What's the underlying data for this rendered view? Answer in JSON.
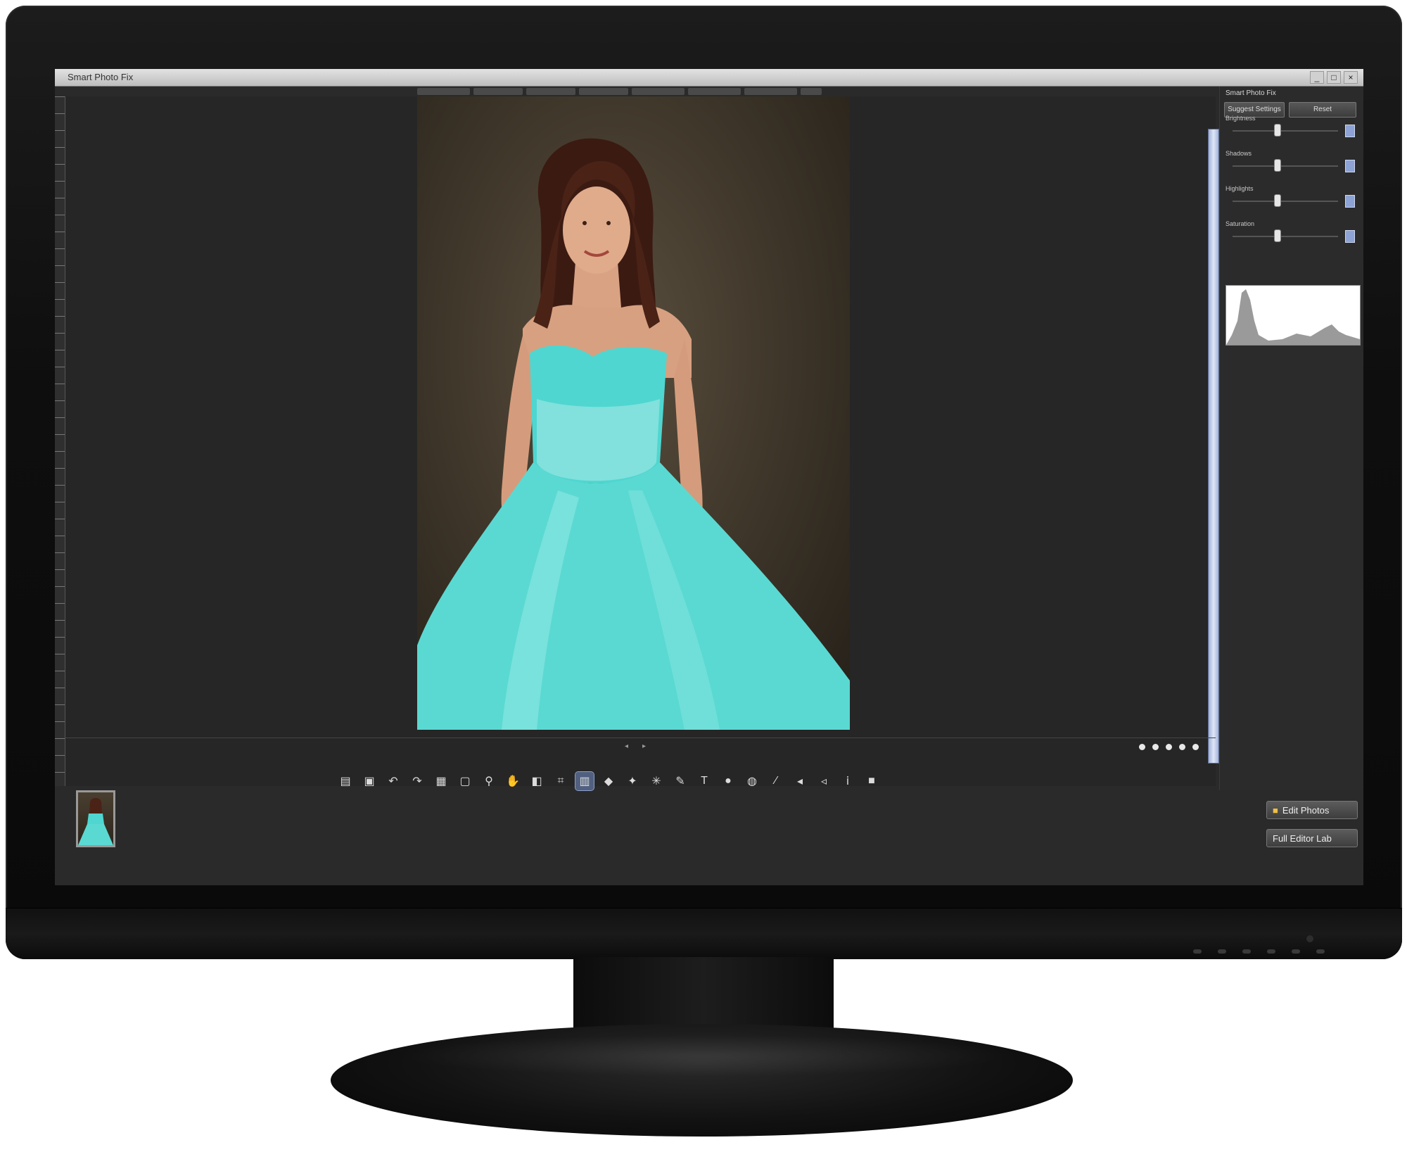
{
  "app": {
    "title": "Smart Photo Fix",
    "window_controls": [
      "_",
      "□",
      "×"
    ]
  },
  "canvas": {
    "nav_arrows": [
      "◂",
      "▸"
    ],
    "photo_description": "portrait"
  },
  "toolbar": {
    "tools": [
      {
        "icon": "open-icon",
        "glyph": "▤"
      },
      {
        "icon": "save-icon",
        "glyph": "▣"
      },
      {
        "icon": "undo-icon",
        "glyph": "↶"
      },
      {
        "icon": "redo-icon",
        "glyph": "↷"
      },
      {
        "icon": "grid-icon",
        "glyph": "▦"
      },
      {
        "icon": "fit-icon",
        "glyph": "▢"
      },
      {
        "icon": "zoom-icon",
        "glyph": "⚲"
      },
      {
        "icon": "pan-icon",
        "glyph": "✋"
      },
      {
        "icon": "compare-icon",
        "glyph": "◧"
      },
      {
        "icon": "crop-icon",
        "glyph": "⌗"
      },
      {
        "icon": "smart-fix-icon",
        "glyph": "▥",
        "active": true
      },
      {
        "icon": "color-icon",
        "glyph": "◆"
      },
      {
        "icon": "magic-icon",
        "glyph": "✦"
      },
      {
        "icon": "star-icon",
        "glyph": "✳"
      },
      {
        "icon": "pen-icon",
        "glyph": "✎"
      },
      {
        "icon": "text-icon",
        "glyph": "T"
      },
      {
        "icon": "redeye-icon",
        "glyph": "●"
      },
      {
        "icon": "globe-icon",
        "glyph": "◍"
      },
      {
        "icon": "brush-icon",
        "glyph": "∕"
      },
      {
        "icon": "retouch-icon",
        "glyph": "◂"
      },
      {
        "icon": "clone-icon",
        "glyph": "◃"
      },
      {
        "icon": "info-icon",
        "glyph": "ⅰ"
      },
      {
        "icon": "export-icon",
        "glyph": "■"
      }
    ]
  },
  "side_buttons": {
    "edit_photos": "Edit Photos",
    "full_editor": "Full Editor Lab"
  },
  "panel": {
    "title": "Smart Photo Fix",
    "btn_suggest": "Suggest Settings",
    "btn_reset": "Reset",
    "sliders": [
      {
        "label": "Brightness",
        "level": 0.4
      },
      {
        "label": "Shadows",
        "level": 0.4
      },
      {
        "label": "Highlights",
        "level": 0.4
      },
      {
        "label": "Saturation",
        "level": 0.4
      }
    ]
  },
  "colors": {
    "accent": "#8da3d5",
    "dress": "#4fd6d0",
    "workspace": "#262626"
  }
}
